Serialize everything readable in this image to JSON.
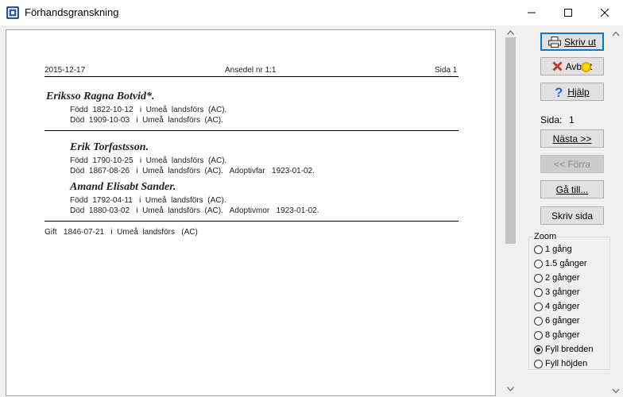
{
  "window": {
    "title": "Förhandsgranskning"
  },
  "page": {
    "header": {
      "date": "2015-12-17",
      "center": "Ansedel nr 1:1",
      "page": "Sida 1"
    },
    "main_person": {
      "name": "Eriksso Ragna Botvid*.",
      "born": "Född  1822-10-12   i  Umeå  landsförs  (AC).",
      "died": "Död  1909-10-03   i  Umeå  landsförs  (AC)."
    },
    "father": {
      "name": "Erik Torfastsson.",
      "born": "Född  1790-10-25   i  Umeå  landsförs  (AC).",
      "died": "Död  1867-08-26   i  Umeå  landsförs  (AC).   Adoptivfar   1923-01-02."
    },
    "mother": {
      "name": "Amand Elisabt Sander.",
      "born": "Född  1792-04-11   i  Umeå  landsförs  (AC).",
      "died": "Död  1880-03-02   i  Umeå  landsförs  (AC).   Adoptivmor   1923-01-02."
    },
    "marriage": "Gift   1846-07-21   i  Umeå  landsförs   (AC)"
  },
  "buttons": {
    "print": "Skriv ut",
    "cancel": "Avbryt",
    "help": "Hjälp",
    "next": "Nästa >>",
    "prev": "<< Förra",
    "goto": "Gå till...",
    "print_page": "Skriv sida"
  },
  "page_indicator": {
    "label": "Sida:",
    "value": "1"
  },
  "zoom": {
    "label": "Zoom",
    "options": [
      "1 gång",
      "1.5 gånger",
      "2 gånger",
      "3 gånger",
      "4 gånger",
      "6 gånger",
      "8 gånger",
      "Fyll bredden",
      "Fyll höjden"
    ],
    "selected": "Fyll bredden"
  },
  "colors": {
    "accent": "#0078d7",
    "cancel_icon": "#c0392b",
    "help_icon": "#1e6fd9"
  }
}
